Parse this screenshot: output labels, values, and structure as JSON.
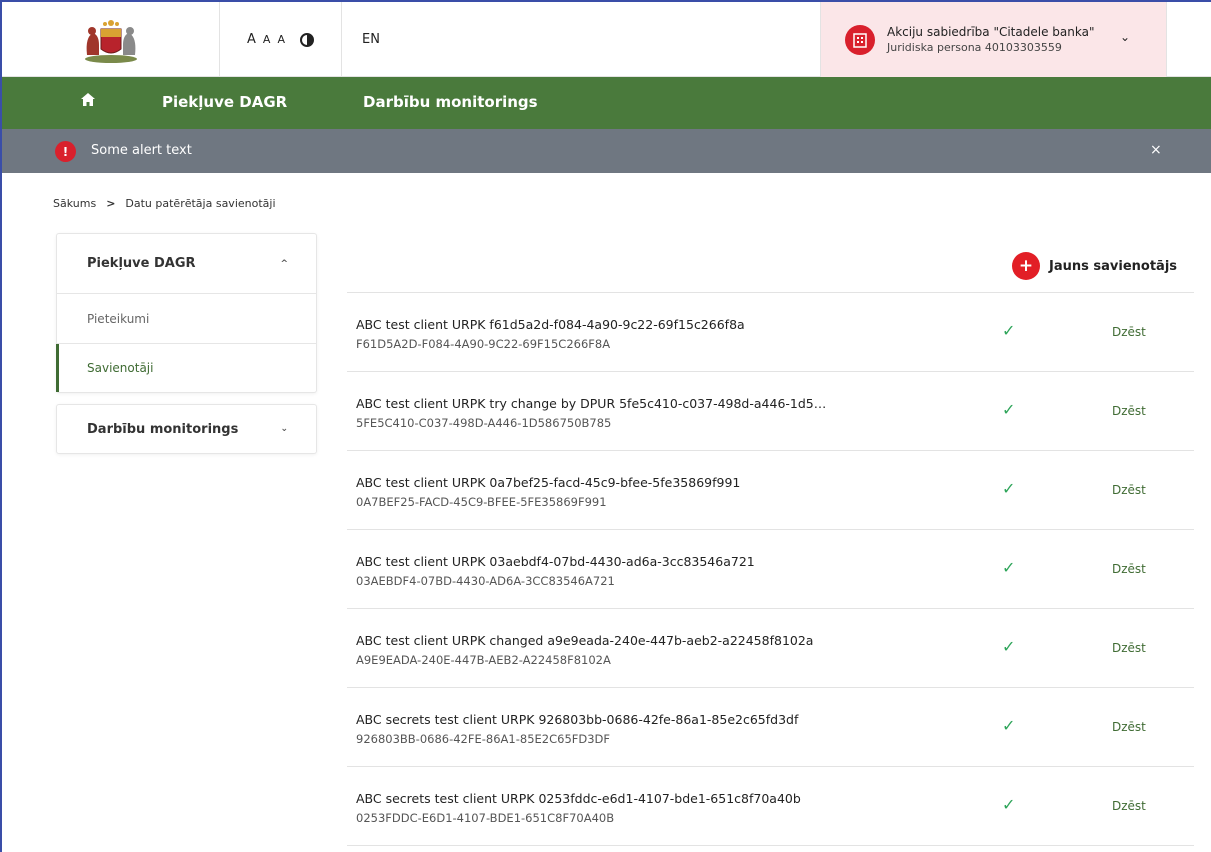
{
  "header": {
    "coat_of_arms": "latvia-coat-of-arms",
    "font_sizes": [
      "A",
      "A",
      "A"
    ],
    "contrast_icon": "contrast-icon",
    "language": "EN",
    "account": {
      "name": "Akciju sabiedrība \"Citadele banka\"",
      "subtitle": "Juridiska persona 40103303559",
      "icon": "building-icon"
    }
  },
  "nav": {
    "home_icon": "home-icon",
    "items": [
      "Piekļuve DAGR",
      "Darbību monitorings"
    ]
  },
  "alert": {
    "text": "Some alert text",
    "close": "×"
  },
  "breadcrumb": {
    "items": [
      "Sākums",
      "Datu patērētāja savienotāji"
    ],
    "separator": ">"
  },
  "sidebar": {
    "sections": [
      {
        "label": "Piekļuve DAGR",
        "expanded": true,
        "items": [
          "Pieteikumi",
          "Savienotāji"
        ],
        "active": "Savienotāji"
      },
      {
        "label": "Darbību monitorings",
        "expanded": false
      }
    ]
  },
  "actions": {
    "new_connector": "Jauns savienotājs"
  },
  "connectors": [
    {
      "title": "ABC test client URPK f61d5a2d-f084-4a90-9c22-69f15c266f8a",
      "id": "F61D5A2D-F084-4A90-9C22-69F15C266F8A",
      "status": "✓",
      "delete": "Dzēst"
    },
    {
      "title": "ABC test client URPK try change by DPUR 5fe5c410-c037-498d-a446-1d5…",
      "id": "5FE5C410-C037-498D-A446-1D586750B785",
      "status": "✓",
      "delete": "Dzēst"
    },
    {
      "title": "ABC test client URPK 0a7bef25-facd-45c9-bfee-5fe35869f991",
      "id": "0A7BEF25-FACD-45C9-BFEE-5FE35869F991",
      "status": "✓",
      "delete": "Dzēst"
    },
    {
      "title": "ABC test client URPK 03aebdf4-07bd-4430-ad6a-3cc83546a721",
      "id": "03AEBDF4-07BD-4430-AD6A-3CC83546A721",
      "status": "✓",
      "delete": "Dzēst"
    },
    {
      "title": "ABC test client URPK changed a9e9eada-240e-447b-aeb2-a22458f8102a",
      "id": "A9E9EADA-240E-447B-AEB2-A22458F8102A",
      "status": "✓",
      "delete": "Dzēst"
    },
    {
      "title": "ABC secrets test client URPK 926803bb-0686-42fe-86a1-85e2c65fd3df",
      "id": "926803BB-0686-42FE-86A1-85E2C65FD3DF",
      "status": "✓",
      "delete": "Dzēst"
    },
    {
      "title": "ABC secrets test client URPK 0253fddc-e6d1-4107-bde1-651c8f70a40b",
      "id": "0253FDDC-E6D1-4107-BDE1-651C8F70A40B",
      "status": "✓",
      "delete": "Dzēst"
    }
  ],
  "colors": {
    "nav_green": "#4a7a3c",
    "alert_grey": "#6f7781",
    "accent_red": "#e21f26",
    "check_green": "#2ea55a",
    "account_bg": "#fbe6e8"
  }
}
